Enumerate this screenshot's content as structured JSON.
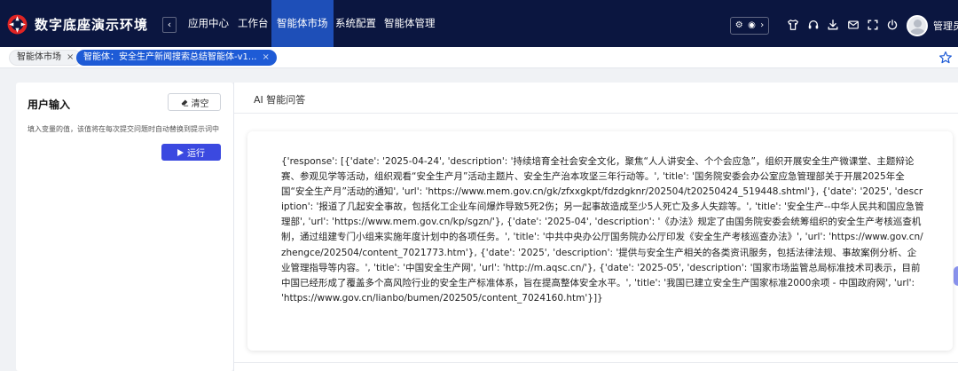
{
  "header": {
    "app_title": "数字底座演示环境",
    "collapse_glyph": "‹",
    "nav": [
      {
        "label": "应用中心",
        "active": false
      },
      {
        "label": "工作台",
        "active": false
      },
      {
        "label": "智能体市场",
        "active": true
      },
      {
        "label": "系统配置",
        "active": false
      },
      {
        "label": "智能体管理",
        "active": false
      }
    ],
    "tools_pill": {
      "icons": [
        "settings-icon",
        "target-icon",
        "chevron-right-icon"
      ],
      "glyphs": [
        "⚙",
        "◉",
        "›"
      ]
    },
    "toolbar_icons": [
      "shirt-icon",
      "headset-icon",
      "download-icon",
      "mail-icon",
      "fullscreen-icon",
      "power-icon"
    ],
    "user_name": "管理员"
  },
  "tabs": [
    {
      "label": "智能体市场",
      "active": false,
      "close": "×"
    },
    {
      "label": "智能体：安全生产新闻搜索总结智能体-v1...",
      "active": true,
      "close": "×"
    }
  ],
  "left_panel": {
    "title": "用户输入",
    "clear_label": "清空",
    "hint": "填入变量的值，该值将在每次提交问题时自动替换到提示词中",
    "run_label": "运行"
  },
  "right_panel": {
    "title": "AI 智能问答",
    "answer": "{'response': [{'date': '2025-04-24', 'description': '持续培育全社会安全文化，聚焦“人人讲安全、个个会应急”，组织开展安全生产微课堂、主题辩论赛、参观见学等活动，组织观看“安全生产月”活动主题片、安全生产治本攻坚三年行动等。', 'title': '国务院安委会办公室应急管理部关于开展2025年全国“安全生产月”活动的通知', 'url': 'https://www.mem.gov.cn/gk/zfxxgkpt/fdzdgknr/202504/t20250424_519448.shtml'}, {'date': '2025', 'description': '报道了几起安全事故，包括化工企业车间爆炸导致5死2伤；另一起事故造成至少5人死亡及多人失踪等。', 'title': '安全生产--中华人民共和国应急管理部', 'url': 'https://www.mem.gov.cn/kp/sgzn/'}, {'date': '2025-04', 'description': '《办法》规定了由国务院安委会统筹组织的安全生产考核巡查机制，通过组建专门小组来实施年度计划中的各项任务。', 'title': '中共中央办公厅国务院办公厅印发《安全生产考核巡查办法》', 'url': 'https://www.gov.cn/zhengce/202504/content_7021773.htm'}, {'date': '2025', 'description': '提供与安全生产相关的各类资讯服务，包括法律法规、事故案例分析、企业管理指导等内容。', 'title': '中国安全生产网', 'url': 'http://m.aqsc.cn/'}, {'date': '2025-05', 'description': '国家市场监管总局标准技术司表示，目前中国已经形成了覆盖多个高风险行业的安全生产标准体系，旨在提高整体安全水平。', 'title': '我国已建立安全生产国家标准2000余项 - 中国政府网', 'url': 'https://www.gov.cn/lianbo/bumen/202505/content_7024160.htm'}]}"
  },
  "colors": {
    "header_bg": "#0b1640",
    "nav_active_bg": "#1e4fb8",
    "tab_active_bg": "#1e5bd6",
    "run_button_bg": "#3b49e0",
    "logo_red": "#e02424"
  }
}
